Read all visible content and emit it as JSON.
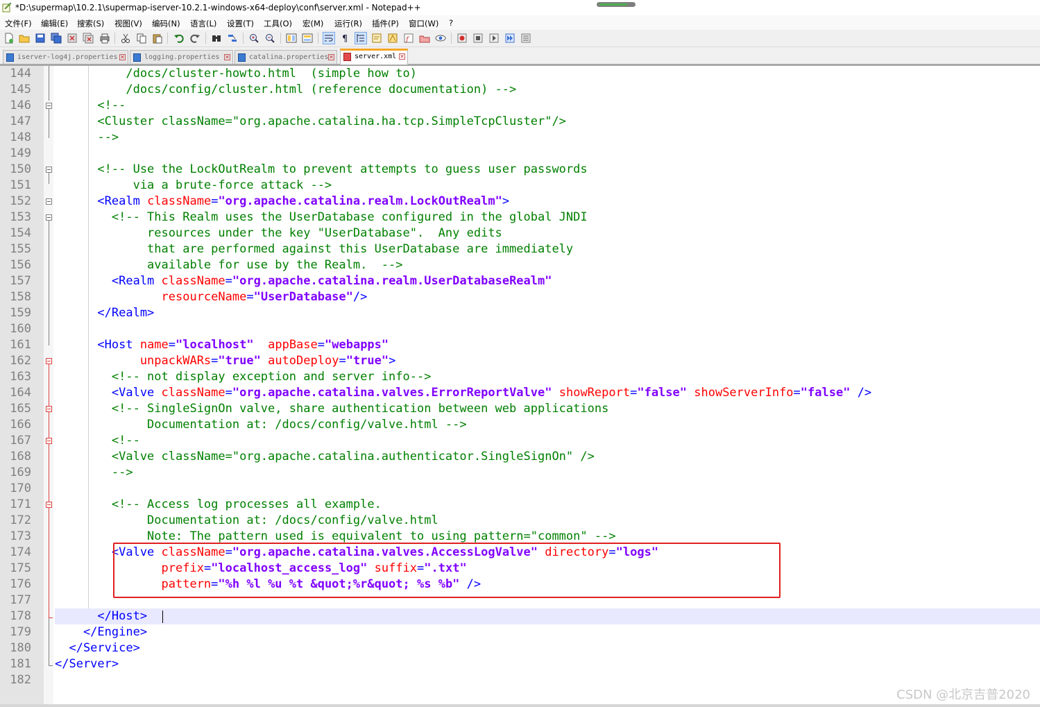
{
  "window": {
    "title": "*D:\\supermap\\10.2.1\\supermap-iserver-10.2.1-windows-x64-deploy\\conf\\server.xml - Notepad++"
  },
  "menu": [
    "文件(F)",
    "编辑(E)",
    "搜索(S)",
    "视图(V)",
    "编码(N)",
    "语言(L)",
    "设置(T)",
    "工具(O)",
    "宏(M)",
    "运行(R)",
    "插件(P)",
    "窗口(W)",
    "?"
  ],
  "toolbar_icons": [
    "new-file-icon",
    "open-file-icon",
    "save-icon",
    "save-all-icon",
    "close-icon",
    "close-all-icon",
    "print-icon",
    "cut-icon",
    "copy-icon",
    "paste-icon",
    "undo-icon",
    "redo-icon",
    "find-icon",
    "replace-icon",
    "zoom-in-icon",
    "zoom-out-icon",
    "sync-vertical-icon",
    "sync-horizontal-icon",
    "word-wrap-icon",
    "show-all-chars-icon",
    "indent-guide-icon",
    "udl-icon",
    "doc-map-icon",
    "function-list-icon",
    "folder-workspace-icon",
    "monitor-icon",
    "record-macro-icon",
    "stop-record-icon",
    "play-macro-icon",
    "run-macro-multiple-icon",
    "save-macro-icon"
  ],
  "tabs": [
    {
      "label": "iserver-log4j.properties",
      "active": false
    },
    {
      "label": "logging.properties",
      "active": false
    },
    {
      "label": "catalina.properties",
      "active": false
    },
    {
      "label": "server.xml",
      "active": true
    }
  ],
  "editor": {
    "colors": {
      "comment": "#008000",
      "tag": "#0000ff",
      "attribute": "#ff0000",
      "value": "#8000ff",
      "highlight_box": "#e02020"
    },
    "lines": [
      {
        "n": "144",
        "segs": [
          [
            "c",
            "          /docs/cluster-howto.html  (simple how to)"
          ]
        ]
      },
      {
        "n": "145",
        "segs": [
          [
            "c",
            "          /docs/config/cluster.html (reference documentation) -->"
          ]
        ]
      },
      {
        "n": "146",
        "segs": [
          [
            "c",
            "      <!--"
          ]
        ]
      },
      {
        "n": "147",
        "segs": [
          [
            "c",
            "      <Cluster className=\"org.apache.catalina.ha.tcp.SimpleTcpCluster\"/>"
          ]
        ]
      },
      {
        "n": "148",
        "segs": [
          [
            "c",
            "      -->"
          ]
        ]
      },
      {
        "n": "149",
        "segs": []
      },
      {
        "n": "150",
        "segs": [
          [
            "c",
            "      <!-- Use the LockOutRealm to prevent attempts to guess user passwords"
          ]
        ]
      },
      {
        "n": "151",
        "segs": [
          [
            "c",
            "           via a brute-force attack -->"
          ]
        ]
      },
      {
        "n": "152",
        "segs": [
          [
            "t",
            "      <Realm "
          ],
          [
            "a",
            "className"
          ],
          [
            "t",
            "="
          ],
          [
            "v",
            "\"org.apache.catalina.realm.LockOutRealm\""
          ],
          [
            "t",
            ">"
          ]
        ]
      },
      {
        "n": "153",
        "segs": [
          [
            "c",
            "        <!-- This Realm uses the UserDatabase configured in the global JNDI"
          ]
        ]
      },
      {
        "n": "154",
        "segs": [
          [
            "c",
            "             resources under the key \"UserDatabase\".  Any edits"
          ]
        ]
      },
      {
        "n": "155",
        "segs": [
          [
            "c",
            "             that are performed against this UserDatabase are immediately"
          ]
        ]
      },
      {
        "n": "156",
        "segs": [
          [
            "c",
            "             available for use by the Realm.  -->"
          ]
        ]
      },
      {
        "n": "157",
        "segs": [
          [
            "t",
            "        <Realm "
          ],
          [
            "a",
            "className"
          ],
          [
            "t",
            "="
          ],
          [
            "v",
            "\"org.apache.catalina.realm.UserDatabaseRealm\""
          ]
        ]
      },
      {
        "n": "158",
        "segs": [
          [
            "a",
            "               resourceName"
          ],
          [
            "t",
            "="
          ],
          [
            "v",
            "\"UserDatabase\""
          ],
          [
            "t",
            "/>"
          ]
        ]
      },
      {
        "n": "159",
        "segs": [
          [
            "t",
            "      </Realm>"
          ]
        ]
      },
      {
        "n": "160",
        "segs": []
      },
      {
        "n": "161",
        "segs": [
          [
            "t",
            "      <Host "
          ],
          [
            "a",
            "name"
          ],
          [
            "t",
            "="
          ],
          [
            "v",
            "\"localhost\""
          ],
          [
            "t",
            "  "
          ],
          [
            "a",
            "appBase"
          ],
          [
            "t",
            "="
          ],
          [
            "v",
            "\"webapps\""
          ]
        ]
      },
      {
        "n": "162",
        "segs": [
          [
            "a",
            "            unpackWARs"
          ],
          [
            "t",
            "="
          ],
          [
            "v",
            "\"true\""
          ],
          [
            "t",
            " "
          ],
          [
            "a",
            "autoDeploy"
          ],
          [
            "t",
            "="
          ],
          [
            "v",
            "\"true\""
          ],
          [
            "t",
            ">"
          ]
        ]
      },
      {
        "n": "163",
        "segs": [
          [
            "c",
            "        <!-- not display exception and server info-->"
          ]
        ]
      },
      {
        "n": "164",
        "segs": [
          [
            "t",
            "        <Valve "
          ],
          [
            "a",
            "className"
          ],
          [
            "t",
            "="
          ],
          [
            "v",
            "\"org.apache.catalina.valves.ErrorReportValve\""
          ],
          [
            "t",
            " "
          ],
          [
            "a",
            "showReport"
          ],
          [
            "t",
            "="
          ],
          [
            "v",
            "\"false\""
          ],
          [
            "t",
            " "
          ],
          [
            "a",
            "showServerInfo"
          ],
          [
            "t",
            "="
          ],
          [
            "v",
            "\"false\""
          ],
          [
            "t",
            " />"
          ]
        ]
      },
      {
        "n": "165",
        "segs": [
          [
            "c",
            "        <!-- SingleSignOn valve, share authentication between web applications"
          ]
        ]
      },
      {
        "n": "166",
        "segs": [
          [
            "c",
            "             Documentation at: /docs/config/valve.html -->"
          ]
        ]
      },
      {
        "n": "167",
        "segs": [
          [
            "c",
            "        <!--"
          ]
        ]
      },
      {
        "n": "168",
        "segs": [
          [
            "c",
            "        <Valve className=\"org.apache.catalina.authenticator.SingleSignOn\" />"
          ]
        ]
      },
      {
        "n": "169",
        "segs": [
          [
            "c",
            "        -->"
          ]
        ]
      },
      {
        "n": "170",
        "segs": []
      },
      {
        "n": "171",
        "segs": [
          [
            "c",
            "        <!-- Access log processes all example."
          ]
        ]
      },
      {
        "n": "172",
        "segs": [
          [
            "c",
            "             Documentation at: /docs/config/valve.html"
          ]
        ]
      },
      {
        "n": "173",
        "segs": [
          [
            "c",
            "             Note: The pattern used is equivalent to using pattern=\"common\" -->"
          ]
        ]
      },
      {
        "n": "174",
        "segs": [
          [
            "t",
            "        <Valve "
          ],
          [
            "a",
            "className"
          ],
          [
            "t",
            "="
          ],
          [
            "v",
            "\"org.apache.catalina.valves.AccessLogValve\""
          ],
          [
            "t",
            " "
          ],
          [
            "a",
            "directory"
          ],
          [
            "t",
            "="
          ],
          [
            "v",
            "\"logs\""
          ]
        ]
      },
      {
        "n": "175",
        "segs": [
          [
            "a",
            "               prefix"
          ],
          [
            "t",
            "="
          ],
          [
            "v",
            "\"localhost_access_log\""
          ],
          [
            "t",
            " "
          ],
          [
            "a",
            "suffix"
          ],
          [
            "t",
            "="
          ],
          [
            "v",
            "\".txt\""
          ]
        ]
      },
      {
        "n": "176",
        "segs": [
          [
            "a",
            "               pattern"
          ],
          [
            "t",
            "="
          ],
          [
            "v",
            "\"%h %l %u %t &quot;%r&quot; %s %b\""
          ],
          [
            "t",
            " />"
          ]
        ]
      },
      {
        "n": "177",
        "segs": []
      },
      {
        "n": "178",
        "segs": [
          [
            "t",
            "      </Host>"
          ]
        ]
      },
      {
        "n": "179",
        "segs": [
          [
            "t",
            "    </Engine>"
          ]
        ]
      },
      {
        "n": "180",
        "segs": [
          [
            "t",
            "  </Service>"
          ]
        ]
      },
      {
        "n": "181",
        "segs": [
          [
            "t",
            "</Server>"
          ]
        ]
      },
      {
        "n": "182",
        "segs": []
      }
    ]
  },
  "watermark": "CSDN @北京吉普2020"
}
